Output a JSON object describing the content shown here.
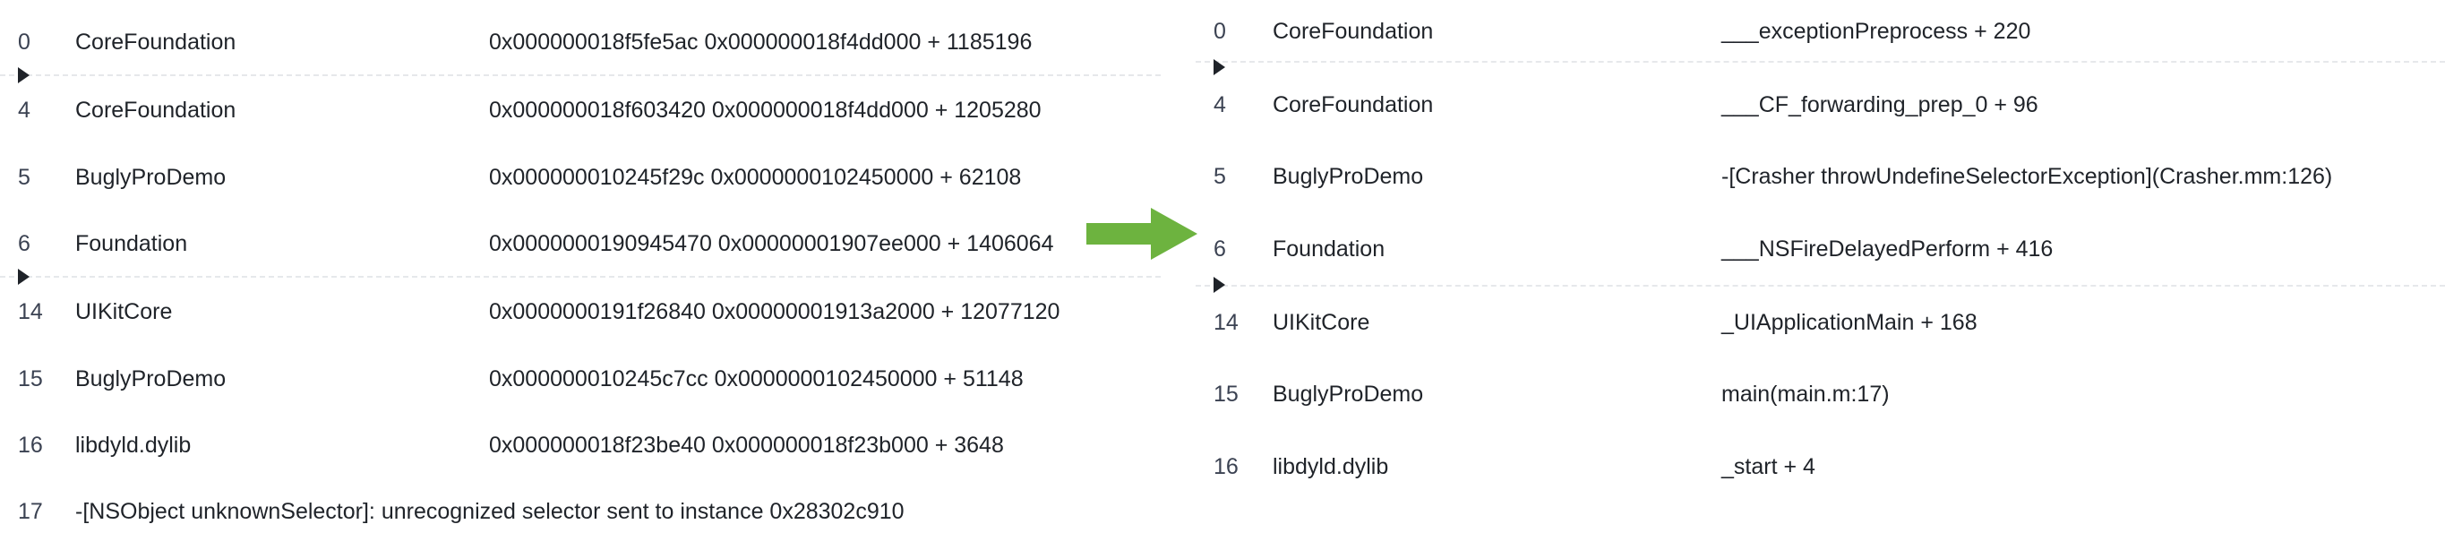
{
  "left_panel": {
    "rows": [
      {
        "index": "0",
        "module": "CoreFoundation",
        "address": "0x000000018f5fe5ac 0x000000018f4dd000 + 1185196"
      },
      {
        "index": "4",
        "module": "CoreFoundation",
        "address": "0x000000018f603420 0x000000018f4dd000 + 1205280"
      },
      {
        "index": "5",
        "module": "BuglyProDemo",
        "address": "0x000000010245f29c 0x0000000102450000 + 62108"
      },
      {
        "index": "6",
        "module": "Foundation",
        "address": "0x0000000190945470 0x00000001907ee000 + 1406064"
      },
      {
        "index": "14",
        "module": "UIKitCore",
        "address": "0x0000000191f26840 0x00000001913a2000 + 12077120"
      },
      {
        "index": "15",
        "module": "BuglyProDemo",
        "address": "0x000000010245c7cc 0x0000000102450000 + 51148"
      },
      {
        "index": "16",
        "module": "libdyld.dylib",
        "address": "0x000000018f23be40 0x000000018f23b000 + 3648"
      },
      {
        "index": "17",
        "module": "-[NSObject unknownSelector]: unrecognized selector sent to instance 0x28302c910",
        "address": ""
      }
    ]
  },
  "right_panel": {
    "rows": [
      {
        "index": "0",
        "module": "CoreFoundation",
        "symbol": "___exceptionPreprocess + 220"
      },
      {
        "index": "4",
        "module": "CoreFoundation",
        "symbol": "___CF_forwarding_prep_0 + 96"
      },
      {
        "index": "5",
        "module": "BuglyProDemo",
        "symbol": "-[Crasher throwUndefineSelectorException](Crasher.mm:126)"
      },
      {
        "index": "6",
        "module": "Foundation",
        "symbol": "___NSFireDelayedPerform + 416"
      },
      {
        "index": "14",
        "module": "UIKitCore",
        "symbol": "_UIApplicationMain + 168"
      },
      {
        "index": "15",
        "module": "BuglyProDemo",
        "symbol": "main(main.m:17)"
      },
      {
        "index": "16",
        "module": "libdyld.dylib",
        "symbol": "_start + 4"
      }
    ]
  },
  "colors": {
    "arrow": "#6db33f",
    "separator": "#e6e8eb",
    "text": "#1f2329"
  },
  "icons": {
    "expand": "caret-right-icon",
    "transform": "arrow-right-icon"
  }
}
